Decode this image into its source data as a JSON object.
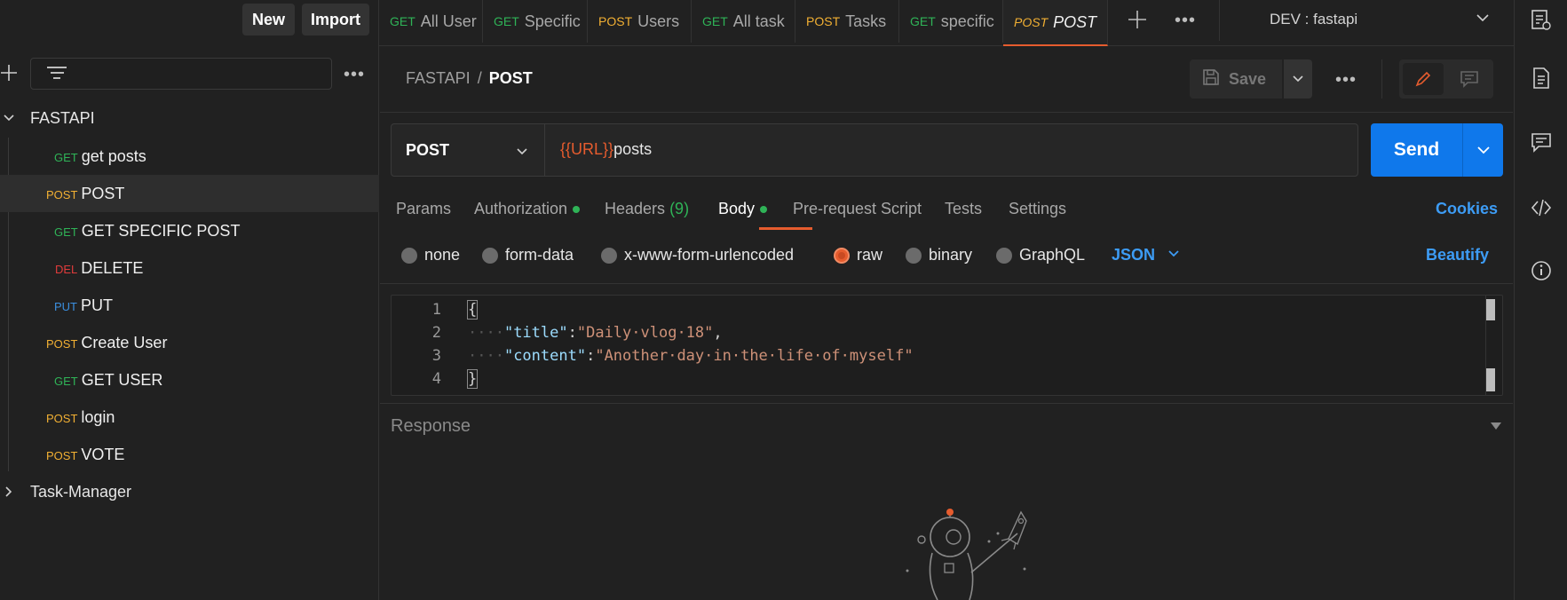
{
  "sidebar": {
    "new_label": "New",
    "import_label": "Import",
    "collections": [
      {
        "name": "FASTAPI",
        "expanded": true,
        "requests": [
          {
            "method": "GET",
            "name": "get posts"
          },
          {
            "method": "POST",
            "name": "POST",
            "active": true
          },
          {
            "method": "GET",
            "name": "GET SPECIFIC POST"
          },
          {
            "method": "DEL",
            "name": "DELETE"
          },
          {
            "method": "PUT",
            "name": "PUT"
          },
          {
            "method": "POST",
            "name": "Create User"
          },
          {
            "method": "GET",
            "name": "GET USER"
          },
          {
            "method": "POST",
            "name": "login"
          },
          {
            "method": "POST",
            "name": "VOTE"
          }
        ]
      },
      {
        "name": "Task-Manager",
        "expanded": false
      }
    ]
  },
  "tabs": [
    {
      "method": "GET",
      "name": "All User"
    },
    {
      "method": "GET",
      "name": "Specific"
    },
    {
      "method": "POST",
      "name": "Users"
    },
    {
      "method": "GET",
      "name": "All task"
    },
    {
      "method": "POST",
      "name": "Tasks"
    },
    {
      "method": "GET",
      "name": "specific"
    },
    {
      "method": "POST",
      "name": "POST",
      "active": true
    }
  ],
  "environment": {
    "selected": "DEV : fastapi"
  },
  "request": {
    "breadcrumb_collection": "FASTAPI",
    "breadcrumb_separator": "/",
    "breadcrumb_request": "POST",
    "save_label": "Save",
    "method": "POST",
    "url_variable": "{{URL}}",
    "url_path": "posts",
    "send_label": "Send"
  },
  "request_tabs": {
    "params": "Params",
    "authorization": "Authorization",
    "headers": "Headers",
    "headers_count": "(9)",
    "body": "Body",
    "prerequest": "Pre-request Script",
    "tests": "Tests",
    "settings": "Settings",
    "cookies": "Cookies",
    "active": "Body"
  },
  "body_types": {
    "none": "none",
    "form_data": "form-data",
    "urlencoded": "x-www-form-urlencoded",
    "raw": "raw",
    "binary": "binary",
    "graphql": "GraphQL",
    "selected": "raw",
    "language": "JSON",
    "beautify": "Beautify"
  },
  "editor": {
    "line_numbers": [
      "1",
      "2",
      "3",
      "4"
    ],
    "open_brace": "{",
    "close_brace": "}",
    "indent": "····",
    "line2_key": "\"title\"",
    "line2_value": "\"Daily·vlog·18\"",
    "line3_key": "\"content\"",
    "line3_value": "\"Another·day·in·the·life·of·myself\"",
    "colon": ":",
    "comma": ","
  },
  "response": {
    "title": "Response"
  },
  "colors": {
    "accent": "#e65c2e",
    "primary_button": "#0f78eb",
    "link": "#3d9cf5",
    "get": "#2fb357",
    "post": "#f2b033",
    "delete": "#e03b3b",
    "put": "#3b8fe0"
  },
  "icons": {
    "sidebar_add": "plus-icon",
    "filter": "filter-icon",
    "more": "more-horizontal-icon",
    "save": "save-disk-icon",
    "edit": "pencil-icon",
    "comment": "comment-icon",
    "rail": [
      "api-doc-icon",
      "document-icon",
      "comment-icon",
      "code-icon",
      "info-icon"
    ]
  }
}
